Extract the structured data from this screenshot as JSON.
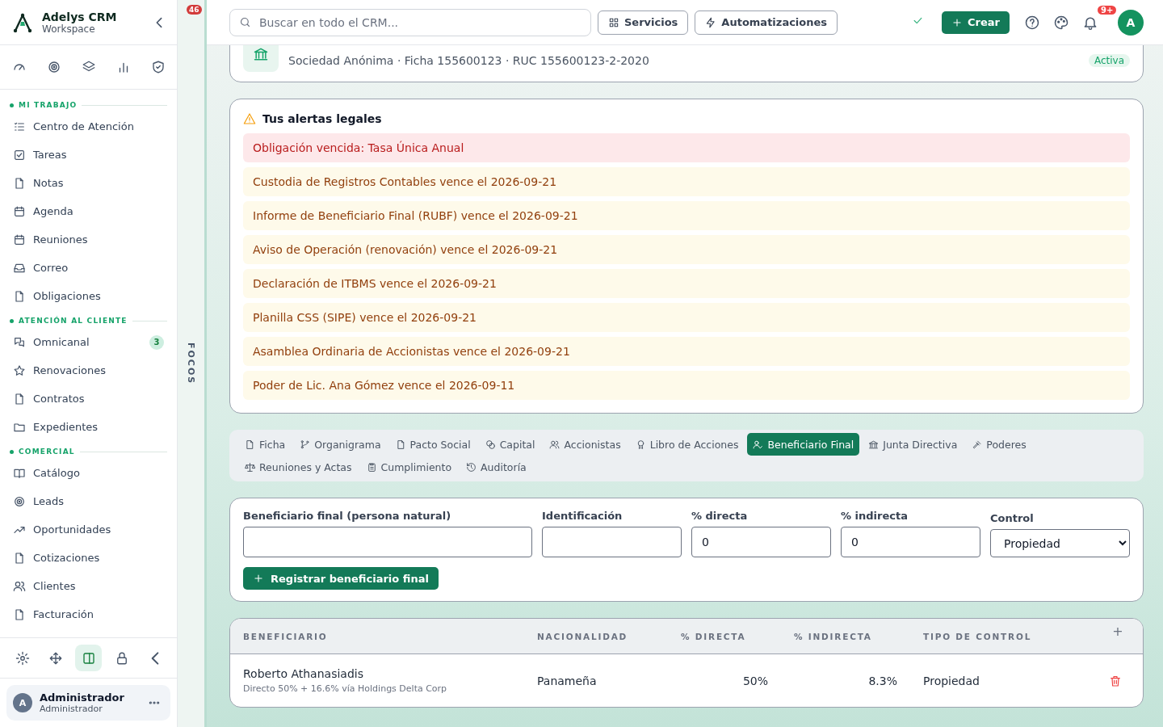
{
  "sidebar": {
    "brand": {
      "name": "Adelys CRM",
      "subtitle": "Workspace"
    },
    "sections": [
      {
        "title": "MI TRABAJO",
        "items": [
          {
            "label": "Centro de Atención"
          },
          {
            "label": "Tareas"
          },
          {
            "label": "Notas"
          },
          {
            "label": "Agenda"
          },
          {
            "label": "Reuniones"
          },
          {
            "label": "Correo"
          },
          {
            "label": "Obligaciones"
          }
        ]
      },
      {
        "title": "ATENCIÓN AL CLIENTE",
        "items": [
          {
            "label": "Omnicanal",
            "badge": "3"
          },
          {
            "label": "Renovaciones"
          },
          {
            "label": "Contratos"
          },
          {
            "label": "Expedientes"
          }
        ]
      },
      {
        "title": "COMERCIAL",
        "items": [
          {
            "label": "Catálogo"
          },
          {
            "label": "Leads"
          },
          {
            "label": "Oportunidades"
          },
          {
            "label": "Cotizaciones"
          },
          {
            "label": "Clientes"
          },
          {
            "label": "Facturación"
          }
        ]
      }
    ],
    "tools": [
      {
        "kind": "settings",
        "selected": false
      },
      {
        "kind": "move",
        "selected": false
      },
      {
        "kind": "panel",
        "selected": true
      },
      {
        "kind": "lock",
        "selected": false
      },
      {
        "kind": "collapse",
        "selected": false
      }
    ],
    "user": {
      "initial": "A",
      "name": "Administrador",
      "role": "Administrador"
    }
  },
  "focus_rail": {
    "label": "FOCOS",
    "badge": "46"
  },
  "topbar": {
    "search": {
      "placeholder": "Buscar en todo el CRM..."
    },
    "buttons": [
      "Servicios",
      "Automatizaciones"
    ],
    "create": "Crear",
    "notifications": "9+",
    "avatar": "A"
  },
  "company": {
    "subtitle": "Sociedad Anónima · Ficha 155600123 · RUC 155600123-2-2020",
    "status": "Activa"
  },
  "alerts": {
    "title": "Tus alertas legales",
    "items": [
      {
        "text": "Obligación vencida: Tasa Única Anual",
        "kind": "danger"
      },
      {
        "text": "Custodia de Registros Contables vence el 2026-09-21",
        "kind": "warning"
      },
      {
        "text": "Informe de Beneficiario Final (RUBF) vence el 2026-09-21",
        "kind": "warning"
      },
      {
        "text": "Aviso de Operación (renovación) vence el 2026-09-21",
        "kind": "warning"
      },
      {
        "text": "Declaración de ITBMS vence el 2026-09-21",
        "kind": "warning"
      },
      {
        "text": "Planilla CSS (SIPE) vence el 2026-09-21",
        "kind": "warning"
      },
      {
        "text": "Asamblea Ordinaria de Accionistas vence el 2026-09-21",
        "kind": "warning"
      },
      {
        "text": "Poder de Lic. Ana Gómez vence el 2026-09-11",
        "kind": "warning"
      }
    ]
  },
  "tabs": [
    {
      "label": "Ficha",
      "selected": false
    },
    {
      "label": "Organigrama",
      "selected": false
    },
    {
      "label": "Pacto Social",
      "selected": false
    },
    {
      "label": "Capital",
      "selected": false
    },
    {
      "label": "Accionistas",
      "selected": false
    },
    {
      "label": "Libro de Acciones",
      "selected": false
    },
    {
      "label": "Beneficiario Final",
      "selected": true
    },
    {
      "label": "Junta Directiva",
      "selected": false
    },
    {
      "label": "Poderes",
      "selected": false
    },
    {
      "label": "Reuniones y Actas",
      "selected": false
    },
    {
      "label": "Cumplimiento",
      "selected": false
    },
    {
      "label": "Auditoría",
      "selected": false
    }
  ],
  "form": {
    "fields": [
      {
        "label": "Beneficiario final (persona natural)",
        "kind": "text"
      },
      {
        "label": "Identificación",
        "kind": "text"
      },
      {
        "label": "% directa",
        "kind": "text",
        "value": "0"
      },
      {
        "label": "% indirecta",
        "kind": "text",
        "value": "0"
      },
      {
        "label": "Control",
        "kind": "select",
        "value": "Propiedad"
      }
    ],
    "submit": "Registrar beneficiario final"
  },
  "table": {
    "columns": [
      "BENEFICIARIO",
      "NACIONALIDAD",
      "% DIRECTA",
      "% INDIRECTA",
      "TIPO DE CONTROL"
    ],
    "add": "+",
    "rows": [
      {
        "name": "Roberto Athanasiadis",
        "detail": "Directo 50% + 16.6% vía Holdings Delta Corp",
        "nationality": "Panameña",
        "direct": "50%",
        "indirect": "8.3%",
        "control": "Propiedad"
      }
    ]
  }
}
